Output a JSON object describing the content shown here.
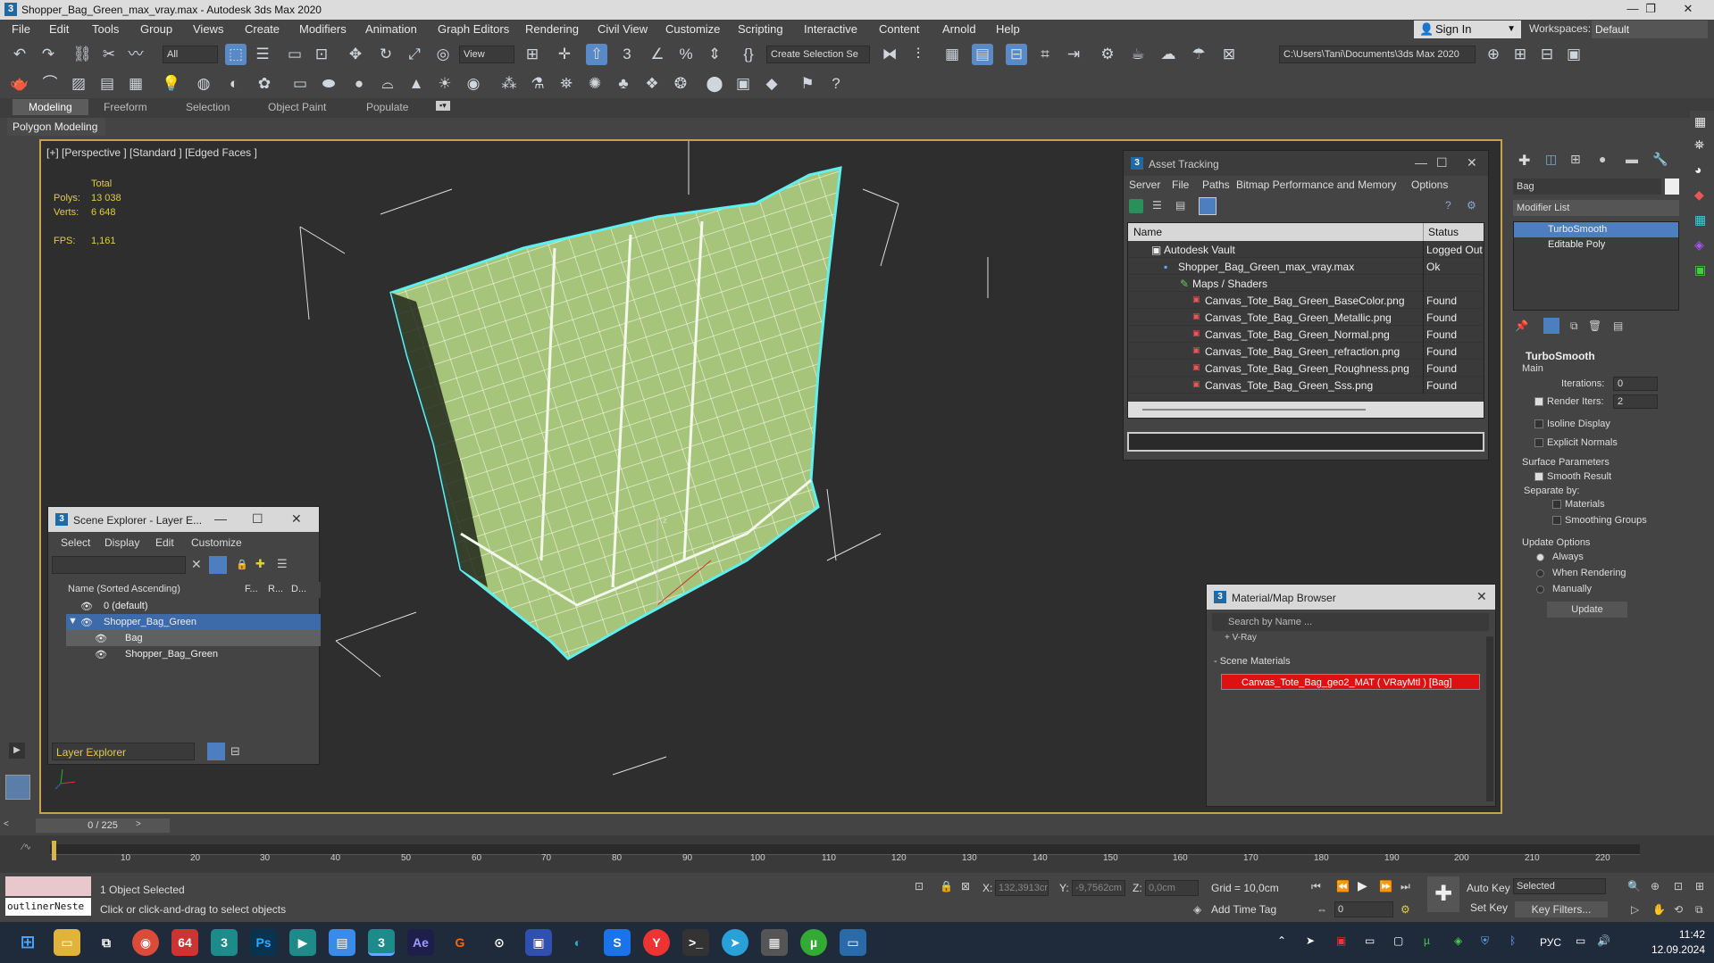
{
  "title": "Shopper_Bag_Green_max_vray.max - Autodesk 3ds Max 2020",
  "menu": [
    "File",
    "Edit",
    "Tools",
    "Group",
    "Views",
    "Create",
    "Modifiers",
    "Animation",
    "Graph Editors",
    "Rendering",
    "Civil View",
    "Customize",
    "Scripting",
    "Interactive",
    "Content",
    "Arnold",
    "Help"
  ],
  "signin": "Sign In",
  "workspaces_label": "Workspaces:",
  "workspace_value": "Default",
  "toolbar": {
    "filter_all": "All",
    "view_dd": "View",
    "create_selection": "Create Selection Se",
    "path": "C:\\Users\\Tani\\Documents\\3ds Max 2020"
  },
  "ribbon": {
    "tabs": [
      "Modeling",
      "Freeform",
      "Selection",
      "Object Paint",
      "Populate"
    ],
    "sub": "Polygon Modeling"
  },
  "viewport": {
    "label": "[+] [Perspective ] [Standard ] [Edged Faces ]",
    "total": "Total",
    "polys_label": "Polys:",
    "polys": "13 038",
    "verts_label": "Verts:",
    "verts": "6 648",
    "fps_label": "FPS:",
    "fps": "1,161"
  },
  "asset": {
    "title": "Asset Tracking",
    "menu": [
      "Server",
      "File",
      "Paths",
      "Bitmap Performance and Memory",
      "Options"
    ],
    "col_name": "Name",
    "col_status": "Status",
    "rows": [
      {
        "name": "Autodesk Vault",
        "status": "Logged Out"
      },
      {
        "name": "Shopper_Bag_Green_max_vray.max",
        "status": "Ok"
      },
      {
        "name": "Maps / Shaders",
        "status": ""
      },
      {
        "name": "Canvas_Tote_Bag_Green_BaseColor.png",
        "status": "Found"
      },
      {
        "name": "Canvas_Tote_Bag_Green_Metallic.png",
        "status": "Found"
      },
      {
        "name": "Canvas_Tote_Bag_Green_Normal.png",
        "status": "Found"
      },
      {
        "name": "Canvas_Tote_Bag_Green_refraction.png",
        "status": "Found"
      },
      {
        "name": "Canvas_Tote_Bag_Green_Roughness.png",
        "status": "Found"
      },
      {
        "name": "Canvas_Tote_Bag_Green_Sss.png",
        "status": "Found"
      }
    ]
  },
  "scene": {
    "title": "Scene Explorer - Layer E...",
    "menu": [
      "Select",
      "Display",
      "Edit",
      "Customize"
    ],
    "col_name": "Name (Sorted Ascending)",
    "col_f": "F...",
    "col_r": "R...",
    "col_d": "D...",
    "rows": [
      "0 (default)",
      "Shopper_Bag_Green",
      "Bag",
      "Shopper_Bag_Green"
    ],
    "layer_explorer": "Layer Explorer"
  },
  "matbrowser": {
    "title": "Material/Map Browser",
    "search": "Search by Name ...",
    "vray": "+ V-Ray",
    "scene_materials": "- Scene Materials",
    "item": "Canvas_Tote_Bag_geo2_MAT ( VRayMtl ) [Bag]"
  },
  "cmd": {
    "name": "Bag",
    "modlist": "Modifier List",
    "stack": [
      "TurboSmooth",
      "Editable Poly"
    ],
    "rollout": "TurboSmooth",
    "main": "Main",
    "iterations_label": "Iterations:",
    "iterations": "0",
    "render_iters_label": "Render Iters:",
    "render_iters": "2",
    "isoline": "Isoline Display",
    "explicit": "Explicit Normals",
    "surface": "Surface Parameters",
    "smooth_result": "Smooth Result",
    "separate_by": "Separate by:",
    "materials": "Materials",
    "smoothing_groups": "Smoothing Groups",
    "update_options": "Update Options",
    "always": "Always",
    "when_rendering": "When Rendering",
    "manually": "Manually",
    "update": "Update"
  },
  "timeline": {
    "slider": "0 / 225",
    "ticks": [
      "10",
      "20",
      "30",
      "40",
      "50",
      "60",
      "70",
      "80",
      "90",
      "100",
      "110",
      "120",
      "130",
      "140",
      "150",
      "160",
      "170",
      "180",
      "190",
      "200",
      "210",
      "220"
    ]
  },
  "status": {
    "script": "outlinerNeste",
    "selected": "1 Object Selected",
    "hint": "Click or click-and-drag to select objects",
    "x_label": "X:",
    "x": "132,3913cr",
    "y_label": "Y:",
    "y": "-9,7562cm",
    "z_label": "Z:",
    "z": "0,0cm",
    "grid": "Grid = 10,0cm",
    "add_time_tag": "Add Time Tag",
    "autokey": "Auto Key",
    "selected_dd": "Selected",
    "setkey": "Set Key",
    "keyfilters": "Key Filters...",
    "frame": "0"
  },
  "taskbar": {
    "lang": "РУС",
    "time": "11:42",
    "date": "12.09.2024"
  }
}
